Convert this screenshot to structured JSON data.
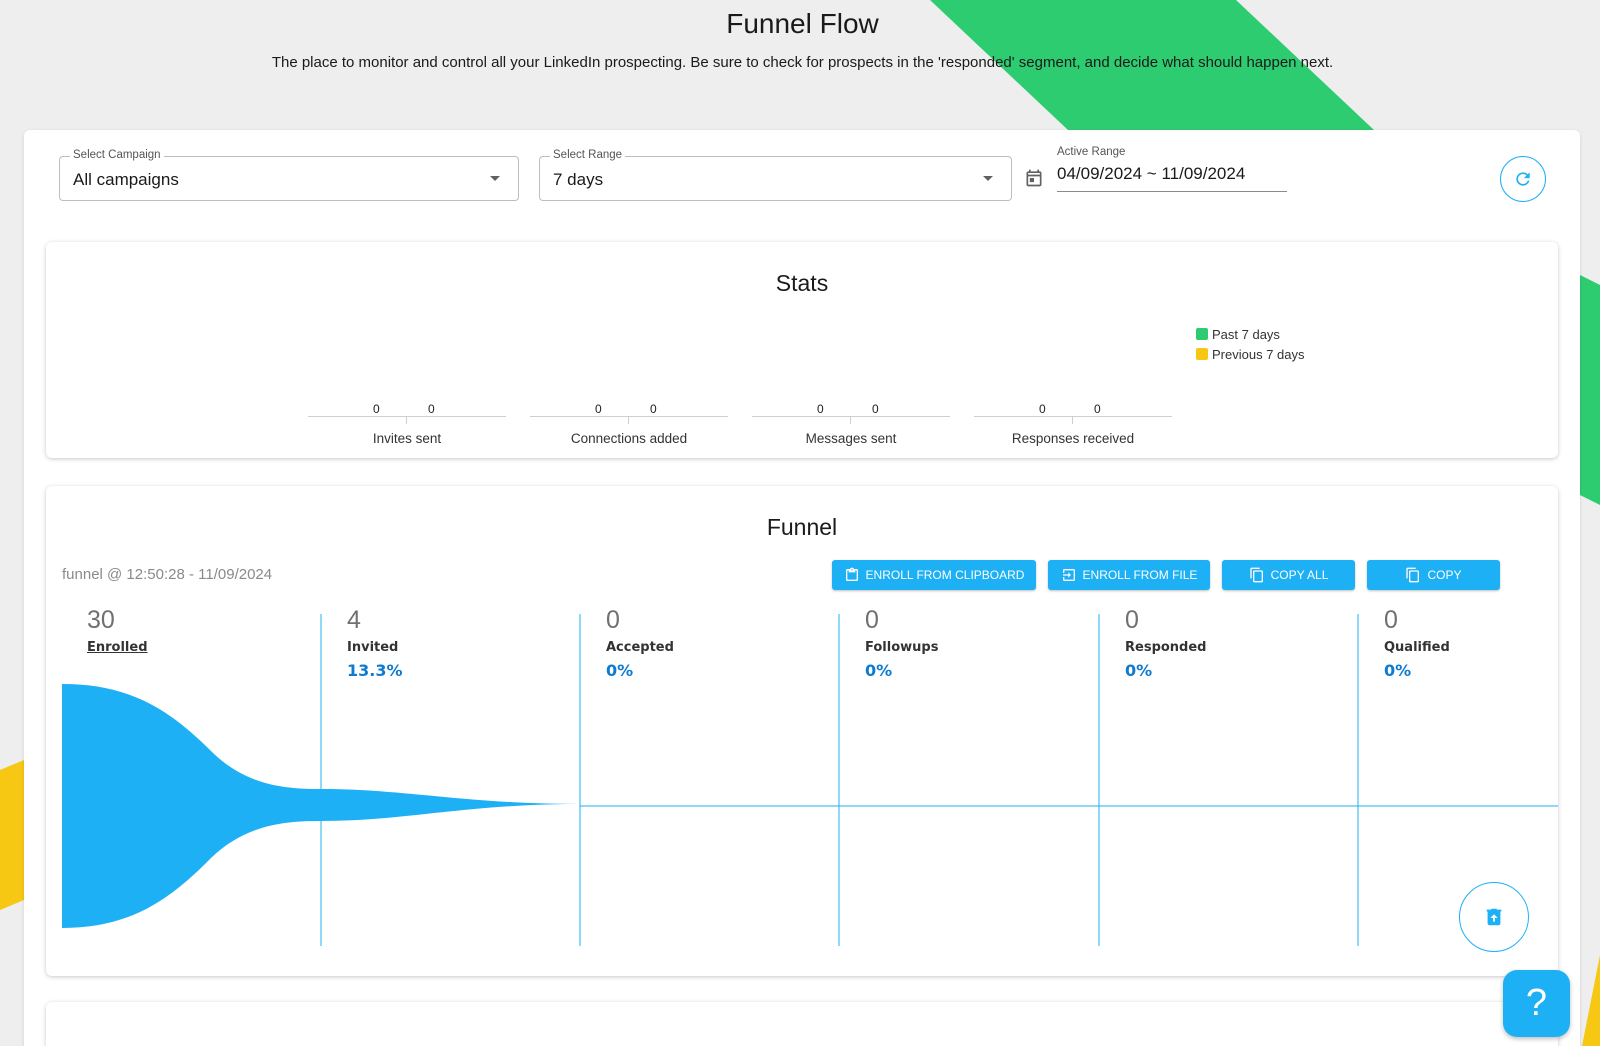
{
  "page": {
    "title": "Funnel Flow",
    "subtitle": "The place to monitor and control all your LinkedIn prospecting. Be sure to check for prospects in the 'responded' segment, and decide what should happen next."
  },
  "colors": {
    "accent": "#1eb0f5",
    "green": "#2ecc71",
    "yellow": "#f6c713",
    "percent_text": "#0e7bd0"
  },
  "filters": {
    "campaign": {
      "label": "Select Campaign",
      "value": "All campaigns"
    },
    "range": {
      "label": "Select Range",
      "value": "7 days"
    },
    "active_range": {
      "label": "Active Range",
      "value": "04/09/2024 ~ 11/09/2024",
      "icon": "calendar-icon"
    },
    "refresh_icon": "refresh-icon"
  },
  "stats": {
    "title": "Stats",
    "legend": [
      {
        "name": "Past 7 days",
        "color": "#2ecc71"
      },
      {
        "name": "Previous 7 days",
        "color": "#f6c713"
      }
    ]
  },
  "chart_data": {
    "type": "bar",
    "title": "Stats",
    "categories": [
      "Invites sent",
      "Connections added",
      "Messages sent",
      "Responses received"
    ],
    "series": [
      {
        "name": "Past 7 days",
        "values": [
          0,
          0,
          0,
          0
        ]
      },
      {
        "name": "Previous 7 days",
        "values": [
          0,
          0,
          0,
          0
        ]
      }
    ],
    "legend_position": "top-right",
    "grid": false
  },
  "funnel": {
    "title": "Funnel",
    "meta": "funnel @ 12:50:28 - 11/09/2024",
    "buttons": {
      "enroll_clipboard": "ENROLL FROM CLIPBOARD",
      "enroll_file": "ENROLL FROM FILE",
      "copy_all": "COPY ALL",
      "copy": "COPY"
    },
    "stages": [
      {
        "count": "30",
        "label": "Enrolled",
        "percent": ""
      },
      {
        "count": "4",
        "label": "Invited",
        "percent": "13.3%"
      },
      {
        "count": "0",
        "label": "Accepted",
        "percent": "0%"
      },
      {
        "count": "0",
        "label": "Followups",
        "percent": "0%"
      },
      {
        "count": "0",
        "label": "Responded",
        "percent": "0%"
      },
      {
        "count": "0",
        "label": "Qualified",
        "percent": "0%"
      }
    ],
    "delete_icon": "trash-icon"
  },
  "help": {
    "label": "?"
  }
}
